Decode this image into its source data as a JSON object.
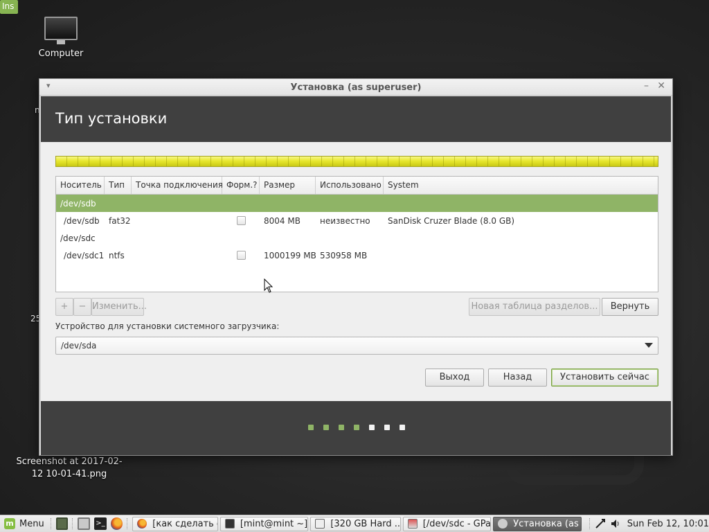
{
  "desktop": {
    "computer_label": "Computer",
    "left_peek_1": "n",
    "left_peek_2": "Ins",
    "left_peek_3": "25",
    "screenshot_label_1": "Screenshot at 2017-02-",
    "screenshot_label_2": "12 10-01-41.png"
  },
  "window": {
    "title": "Установка (as superuser)",
    "header": "Тип установки",
    "table": {
      "columns": [
        "Носитель",
        "Тип",
        "Точка подключения",
        "Форм.?",
        "Размер",
        "Использовано",
        "System"
      ],
      "rows": [
        {
          "device": "/dev/sdb",
          "type": "",
          "mount": "",
          "format": null,
          "size": "",
          "used": "",
          "system": "",
          "group": true,
          "selected": true
        },
        {
          "device": "/dev/sdb",
          "type": "fat32",
          "mount": "",
          "format": false,
          "size": "8004 MB",
          "used": "неизвестно",
          "system": "SanDisk Cruzer Blade (8.0 GB)",
          "group": false,
          "selected": false
        },
        {
          "device": "/dev/sdc",
          "type": "",
          "mount": "",
          "format": null,
          "size": "",
          "used": "",
          "system": "",
          "group": true,
          "selected": false
        },
        {
          "device": "/dev/sdc1",
          "type": "ntfs",
          "mount": "",
          "format": false,
          "size": "1000199 MB",
          "used": "530958 MB",
          "system": "",
          "group": false,
          "selected": false
        }
      ]
    },
    "toolbar": {
      "add_label": "+",
      "remove_label": "−",
      "change_label": "Изменить...",
      "new_table_label": "Новая таблица разделов...",
      "revert_label": "Вернуть"
    },
    "bootloader": {
      "label": "Устройство для установки системного загрузчика:",
      "value": "/dev/sda"
    },
    "actions": {
      "quit_label": "Выход",
      "back_label": "Назад",
      "install_label": "Установить сейчас"
    },
    "progress": {
      "total_steps": 7,
      "completed_steps": 4,
      "active_color": "#8fb466",
      "inactive_color": "#f2f2f2"
    }
  },
  "colors": {
    "accent": "#8fb466",
    "header_bg": "#404040",
    "disk_bar": "#e8e82e"
  },
  "taskbar": {
    "menu_label": "Menu",
    "tasks": [
      {
        "label": "[как сделать с...",
        "icon": "firefox-icon",
        "active": false
      },
      {
        "label": "[mint@mint ~]",
        "icon": "terminal-icon",
        "active": false
      },
      {
        "label": "[320 GB Hard ...",
        "icon": "disk-icon",
        "active": false
      },
      {
        "label": "[/dev/sdc - GPa...",
        "icon": "gparted-icon",
        "active": false
      },
      {
        "label": "Установка (as ...",
        "icon": "installer-icon",
        "active": true
      }
    ],
    "clock": "Sun Feb 12, 10:01"
  }
}
